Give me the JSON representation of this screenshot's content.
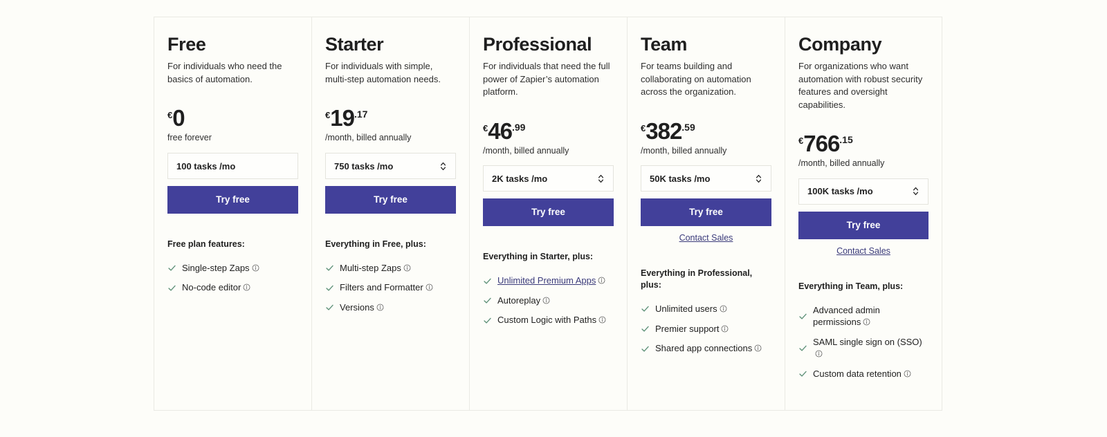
{
  "theme": {
    "page_bg": "#FDFDF9",
    "card_bg": "#FDFDF9",
    "card_border": "#EAEAE4",
    "button_bg": "#42409A",
    "button_text": "#FFFFFF",
    "link_color": "#3A3A7A",
    "check_color": "#5E9178",
    "heading_color": "#1F1F1F"
  },
  "icons": {
    "check": "check-icon",
    "info": "info-circle-icon",
    "chevron_updown": "chevron-up-down-icon"
  },
  "plans": [
    {
      "name": "Free",
      "description": "For individuals who need the basics of automation.",
      "currency": "€",
      "price": "0",
      "cents": "",
      "price_note": "free forever",
      "tasks_label": "100 tasks /mo",
      "has_dropdown": false,
      "cta_label": "Try free",
      "contact_sales_label": "",
      "has_contact_sales": false,
      "features_heading": "Free plan features:",
      "features": [
        {
          "label": "Single-step Zaps",
          "is_link": false,
          "has_info": true
        },
        {
          "label": "No-code editor",
          "is_link": false,
          "has_info": true
        }
      ]
    },
    {
      "name": "Starter",
      "description": "For individuals with simple, multi-step automation needs.",
      "currency": "€",
      "price": "19",
      "cents": ".17",
      "price_note": "/month, billed annually",
      "tasks_label": "750 tasks /mo",
      "has_dropdown": true,
      "cta_label": "Try free",
      "contact_sales_label": "",
      "has_contact_sales": false,
      "features_heading": "Everything in Free, plus:",
      "features": [
        {
          "label": "Multi-step Zaps",
          "is_link": false,
          "has_info": true
        },
        {
          "label": "Filters and Formatter",
          "is_link": false,
          "has_info": true
        },
        {
          "label": "Versions",
          "is_link": false,
          "has_info": true
        }
      ]
    },
    {
      "name": "Professional",
      "description": "For individuals that need the full power of Zapier’s automation platform.",
      "currency": "€",
      "price": "46",
      "cents": ".99",
      "price_note": "/month, billed annually",
      "tasks_label": "2K tasks /mo",
      "has_dropdown": true,
      "cta_label": "Try free",
      "contact_sales_label": "",
      "has_contact_sales": false,
      "features_heading": "Everything in Starter, plus:",
      "features": [
        {
          "label": "Unlimited Premium Apps",
          "is_link": true,
          "has_info": true
        },
        {
          "label": "Autoreplay",
          "is_link": false,
          "has_info": true
        },
        {
          "label": "Custom Logic with Paths",
          "is_link": false,
          "has_info": true
        }
      ]
    },
    {
      "name": "Team",
      "description": "For teams building and collaborating on automation across the organization.",
      "currency": "€",
      "price": "382",
      "cents": ".59",
      "price_note": "/month, billed annually",
      "tasks_label": "50K tasks /mo",
      "has_dropdown": true,
      "cta_label": "Try free",
      "contact_sales_label": "Contact Sales",
      "has_contact_sales": true,
      "features_heading": "Everything in Professional, plus:",
      "features": [
        {
          "label": "Unlimited users",
          "is_link": false,
          "has_info": true
        },
        {
          "label": "Premier support",
          "is_link": false,
          "has_info": true
        },
        {
          "label": "Shared app connections",
          "is_link": false,
          "has_info": true
        }
      ]
    },
    {
      "name": "Company",
      "description": "For organizations who want automation with robust security features and oversight capabilities.",
      "currency": "€",
      "price": "766",
      "cents": ".15",
      "price_note": "/month, billed annually",
      "tasks_label": "100K tasks /mo",
      "has_dropdown": true,
      "cta_label": "Try free",
      "contact_sales_label": "Contact Sales",
      "has_contact_sales": true,
      "features_heading": "Everything in Team, plus:",
      "features": [
        {
          "label": "Advanced admin permissions",
          "is_link": false,
          "has_info": true
        },
        {
          "label": "SAML single sign on (SSO)",
          "is_link": false,
          "has_info": true
        },
        {
          "label": "Custom data retention",
          "is_link": false,
          "has_info": true
        }
      ]
    }
  ]
}
